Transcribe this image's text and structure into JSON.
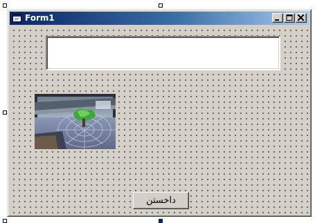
{
  "form": {
    "title": "Form1",
    "textbox_value": "",
    "button_label": "داخستن"
  },
  "icons": {
    "form_icon": "form-icon",
    "minimize": "minimize-icon",
    "maximize": "maximize-icon",
    "close": "close-icon"
  }
}
